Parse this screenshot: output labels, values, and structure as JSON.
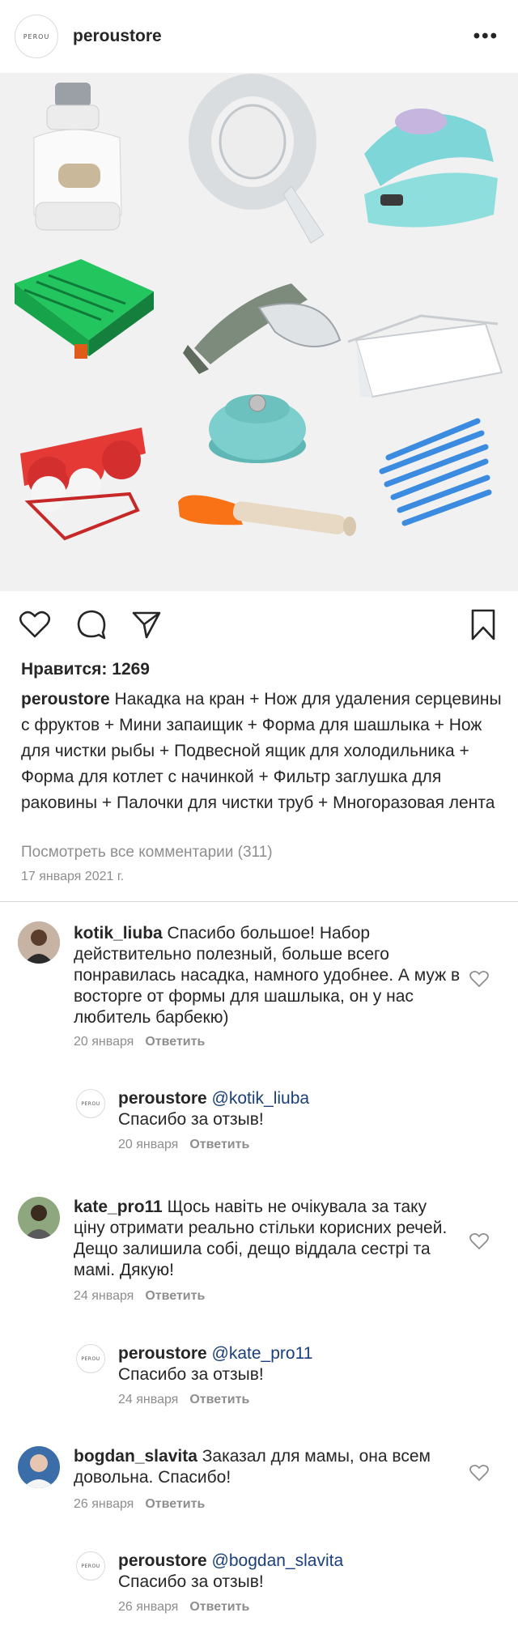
{
  "header": {
    "logo_text": "PEROU",
    "username": "peroustore",
    "more_glyph": "•••",
    "icons": [
      "more-icon"
    ]
  },
  "actions": {
    "icons": [
      "heart-icon",
      "comment-icon",
      "share-icon",
      "bookmark-icon"
    ]
  },
  "post": {
    "likes": "Нравится: 1269",
    "caption_user": "peroustore",
    "caption_text": " Накадка на кран + Нож для удаления серцевины с фруктов + Мини запаищик + Форма для шашлыка + Нож для чистки рыбы + Подвесной ящик для холодильника + Форма для котлет с начинкой + Фильтр заглушка для раковины + Палочки для чистки труб + Многоразовая лента",
    "view_all": "Посмотреть все комментарии (311)",
    "date": "17 января 2021 г."
  },
  "comments": [
    {
      "user": "kotik_liuba",
      "text": " Спасибо большое! Набор действительно полезный, больше всего понравилась насадка, намного удобнее. А муж в восторге от формы для шашлыка, он у нас любитель барбекю)",
      "date": "20 января",
      "reply_label": "Ответить",
      "reply": {
        "user": "peroustore",
        "mention": "@kotik_liuba",
        "text": "Спасибо за отзыв!",
        "date": "20 января",
        "reply_label": "Ответить",
        "logo_text": "PEROU"
      }
    },
    {
      "user": "kate_pro11",
      "text": " Щось навіть не очікувала за таку ціну отримати реально стільки корисних речей. Дещо залишила собі, дещо віддала сестрі та мамі. Дякую!",
      "date": "24 января",
      "reply_label": "Ответить",
      "reply": {
        "user": "peroustore",
        "mention": "@kate_pro11",
        "text": "Спасибо за отзыв!",
        "date": "24 января",
        "reply_label": "Ответить",
        "logo_text": "PEROU"
      }
    },
    {
      "user": "bogdan_slavita",
      "text": " Заказал для мамы, она всем довольна. Спасибо!",
      "date": "26 января",
      "reply_label": "Ответить",
      "reply": {
        "user": "peroustore",
        "mention": "@bogdan_slavita",
        "text": "Спасибо за отзыв!",
        "date": "26 января",
        "reply_label": "Ответить",
        "logo_text": "PEROU"
      }
    }
  ],
  "colors": {
    "text": "#262626",
    "muted": "#8e8e8e",
    "mention": "#1a3f7a",
    "divider": "#dbdbdb"
  }
}
